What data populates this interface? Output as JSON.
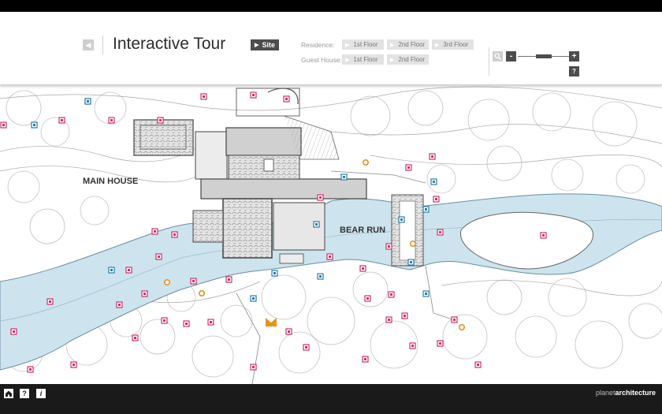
{
  "header": {
    "title": "Interactive Tour",
    "site_label": "Site",
    "residence_label": "Residence:",
    "guest_label": "Guest House:",
    "residence_floors": [
      "1st Floor",
      "2nd Floor",
      "3rd Floor"
    ],
    "guest_floors": [
      "1st Floor",
      "2nd Floor"
    ],
    "zoom_out": "-",
    "zoom_in": "+",
    "help": "?",
    "zoom_level": 0.5
  },
  "map": {
    "main_house_label": "MAIN HOUSE",
    "bear_run_label": "BEAR RUN",
    "water_color": "#cde3ee",
    "pink_marker_color": "#d0306b",
    "blue_marker_color": "#2a7fa3",
    "orange_marker_color": "#e8921e"
  },
  "footer": {
    "home_icon": "home-icon",
    "help_label": "?",
    "info_label": "i",
    "brand_light": "planet",
    "brand_bold": "architecture"
  }
}
